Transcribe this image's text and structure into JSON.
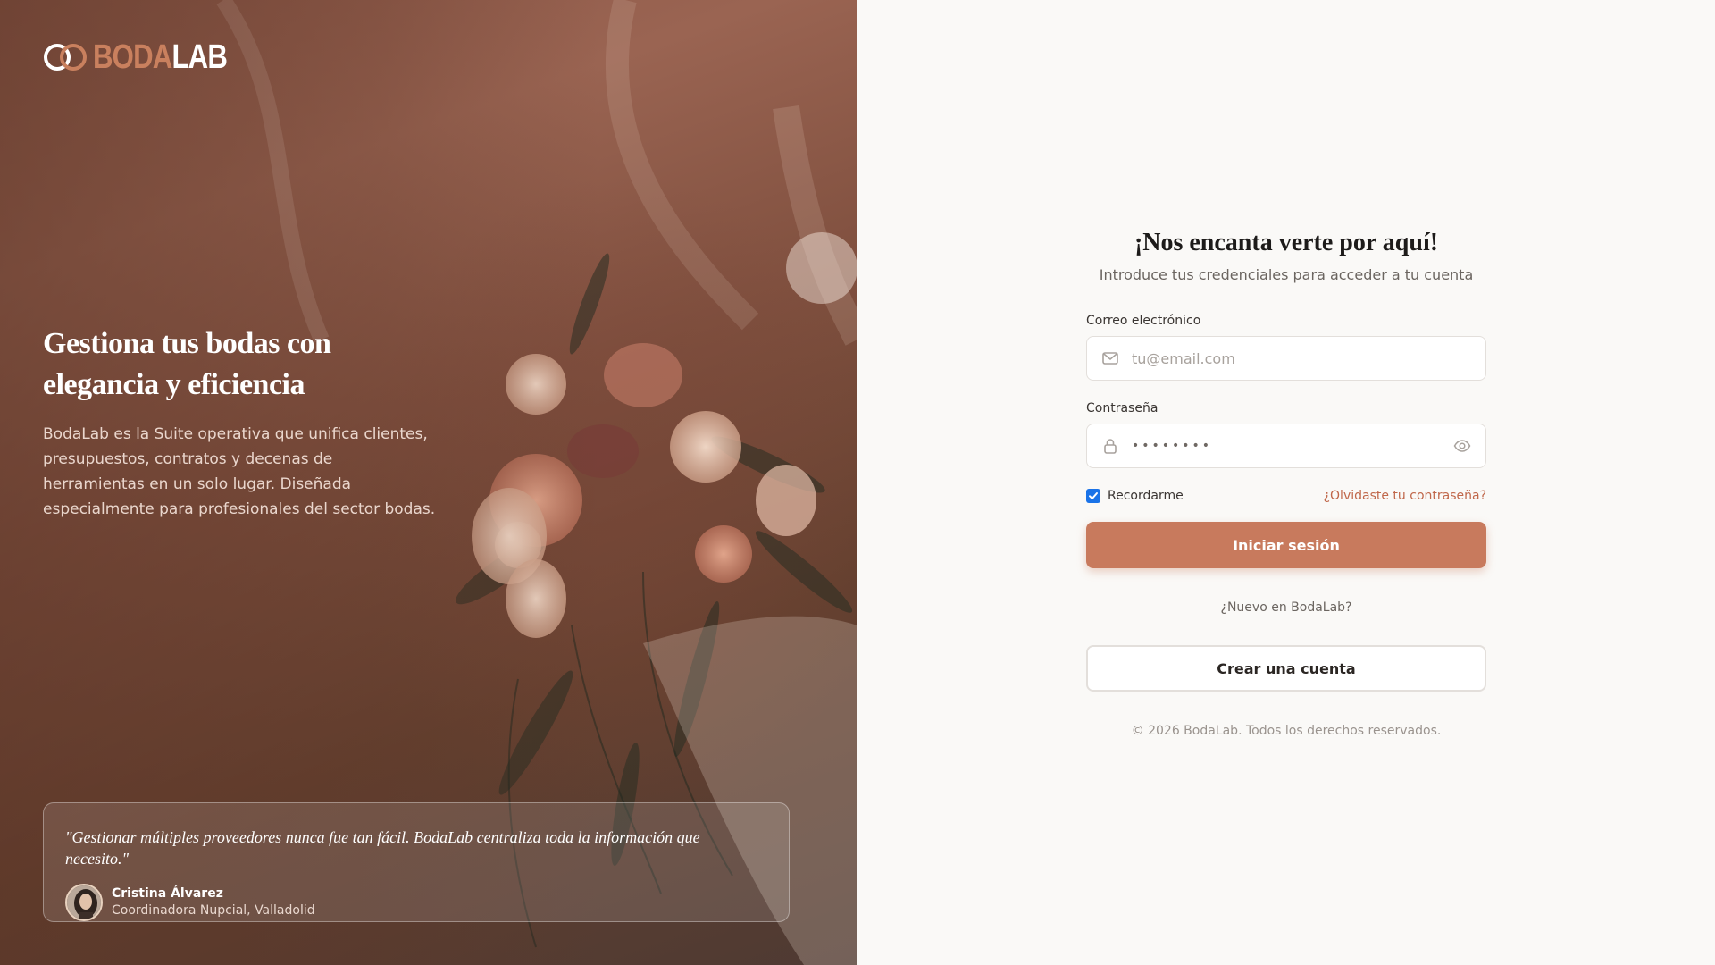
{
  "brand": {
    "name_part1": "BODA",
    "name_part2": "LAB",
    "accent_color": "#c87a5d",
    "logo_icon": "interlocking-rings-icon"
  },
  "hero": {
    "title": "Gestiona tus bodas con elegancia y eficiencia",
    "description": "BodaLab es la Suite operativa que unifica clientes, presupuestos, contratos y decenas de herramientas en un solo lugar. Diseñada especialmente para profesionales del sector bodas.",
    "testimonial": {
      "quote": "\"Gestionar múltiples proveedores nunca fue tan fácil. BodaLab centraliza toda la información que necesito.\"",
      "author_name": "Cristina Álvarez",
      "author_role": "Coordinadora Nupcial, Valladolid"
    }
  },
  "login": {
    "title": "¡Nos encanta verte por aquí!",
    "subtitle": "Introduce tus credenciales para acceder a tu cuenta",
    "email_label": "Correo electrónico",
    "email_placeholder": "tu@email.com",
    "email_value": "",
    "password_label": "Contraseña",
    "password_value": "••••••••",
    "remember_label": "Recordarme",
    "remember_checked": true,
    "forgot_label": "¿Olvidaste tu contraseña?",
    "submit_label": "Iniciar sesión",
    "divider_text": "¿Nuevo en BodaLab?",
    "create_account_label": "Crear una cuenta",
    "footer": "© 2026 BodaLab. Todos los derechos reservados."
  },
  "icons": {
    "email": "mail-icon",
    "password": "lock-icon",
    "toggle_password": "eye-icon",
    "checkbox": "check-icon"
  }
}
